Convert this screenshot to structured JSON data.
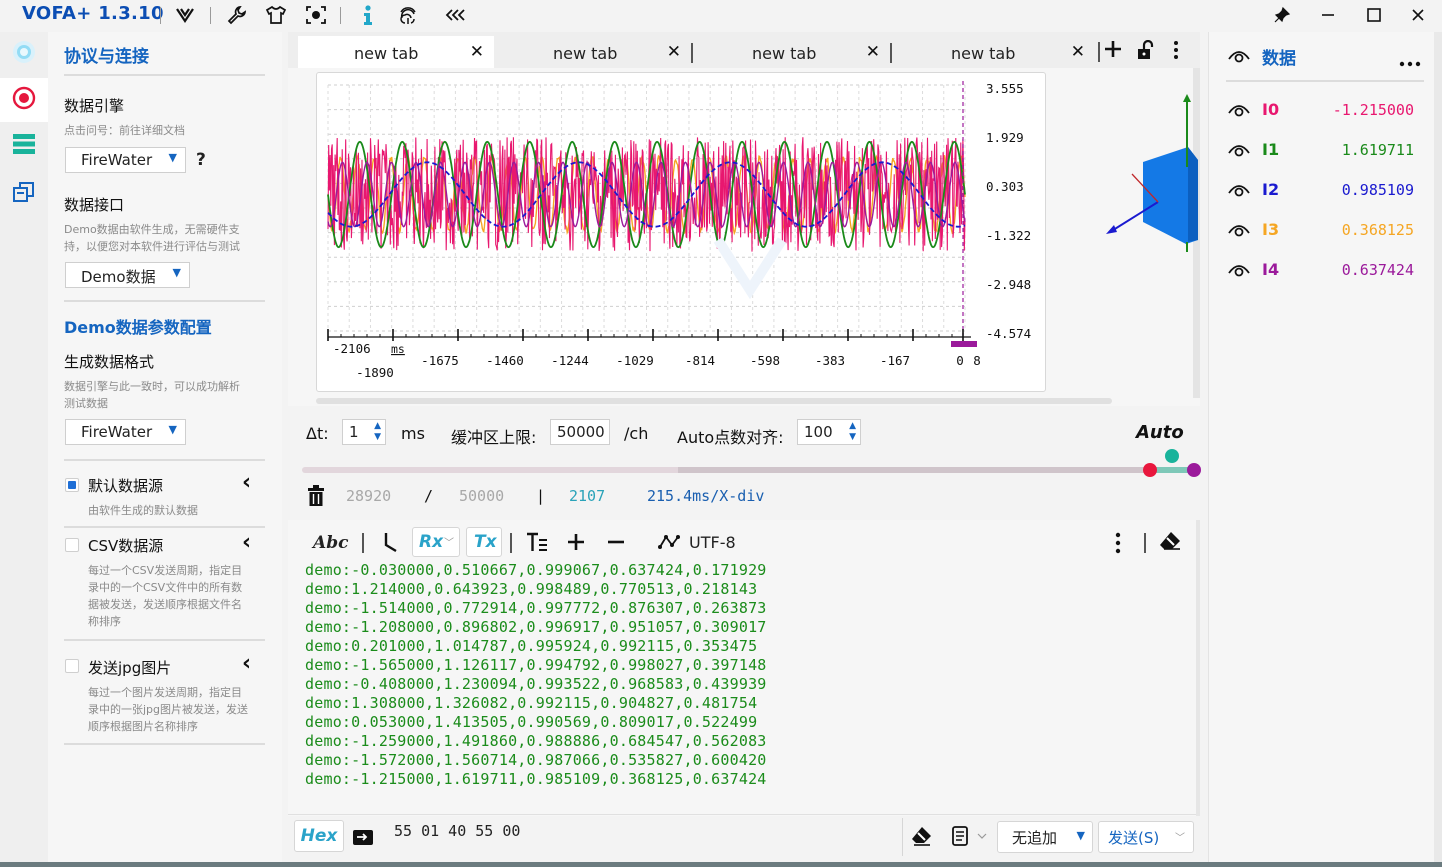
{
  "app": {
    "title": "VOFA+ 1.3.10"
  },
  "colors": {
    "accent": "#1565c0",
    "brand": "#0b4db3",
    "terminal_text": "#1b8c1b",
    "ch0": "#e8176f",
    "ch1": "#1a8a1a",
    "ch2": "#1a1acf",
    "ch3": "#f5a623",
    "ch4": "#9b1a9b"
  },
  "toolbar": {
    "icons": [
      "vofa-logo-icon",
      "wrench-icon",
      "shirt-icon",
      "camera-icon",
      "info-icon",
      "fingerprint-icon",
      "collapse-icon"
    ]
  },
  "left": {
    "section_title": "协议与连接",
    "engine_label": "数据引擎",
    "engine_hint": "点击问号：前往详细文档",
    "engine_value": "FireWater",
    "help": "?",
    "interface_label": "数据接口",
    "interface_hint_1": "Demo数据由软件生成，无需硬件支",
    "interface_hint_2": "持，以便您对本软件进行评估与测试",
    "interface_value": "Demo数据",
    "demo_section_title": "Demo数据参数配置",
    "format_label": "生成数据格式",
    "format_hint_1": "数据引擎与此一致时，可以成功解析",
    "format_hint_2": "测试数据",
    "format_value": "FireWater",
    "sources": [
      {
        "label": "默认数据源",
        "checked": true,
        "hint": [
          "由软件生成的默认数据"
        ]
      },
      {
        "label": "CSV数据源",
        "checked": false,
        "hint": [
          "每过一个CSV发送周期，指定目",
          "录中的一个CSV文件中的所有数",
          "据被发送，发送顺序根据文件名",
          "称排序"
        ]
      },
      {
        "label": "发送jpg图片",
        "checked": false,
        "hint": [
          "每过一个图片发送周期，指定目",
          "录中的一张jpg图片被发送，发送",
          "顺序根据图片名称排序"
        ]
      }
    ]
  },
  "tabs": [
    "new tab",
    "new tab",
    "new tab",
    "new tab"
  ],
  "chart_data": {
    "type": "line",
    "y_ticks": [
      "3.555",
      "1.929",
      "0.303",
      "-1.322",
      "-2.948",
      "-4.574"
    ],
    "ylim": [
      -4.574,
      3.555
    ],
    "x_ticks_top": [
      "-2106",
      "ms"
    ],
    "x_ticks": [
      "-1890",
      "-1675",
      "-1460",
      "-1244",
      "-1029",
      "-814",
      "-598",
      "-383",
      "-167",
      "0",
      "8"
    ],
    "xlabel": "ms",
    "series": [
      {
        "name": "I0",
        "color": "#e8176f"
      },
      {
        "name": "I1",
        "color": "#1a8a1a"
      },
      {
        "name": "I2",
        "color": "#1a1acf"
      },
      {
        "name": "I3",
        "color": "#f5a623"
      },
      {
        "name": "I4",
        "color": "#9b1a9b"
      }
    ]
  },
  "controls": {
    "dt_label": "Δt:",
    "dt_value": "1",
    "dt_unit": "ms",
    "buffer_label": "缓冲区上限:",
    "buffer_value": "50000",
    "buffer_unit": "/ch",
    "align_label": "Auto点数对齐:",
    "align_value": "100",
    "auto": "Auto",
    "count": "28920",
    "slash": "/",
    "limit": "50000",
    "bar": "|",
    "points": "2107",
    "xdiv": "215.4ms/X-div"
  },
  "terminal": {
    "abc": "Abc",
    "rx": "Rx",
    "tx": "Tx",
    "encoding": "UTF-8",
    "lines": [
      "demo:-0.030000,0.510667,0.999067,0.637424,0.171929",
      "demo:1.214000,0.643923,0.998489,0.770513,0.218143",
      "demo:-1.514000,0.772914,0.997772,0.876307,0.263873",
      "demo:-1.208000,0.896802,0.996917,0.951057,0.309017",
      "demo:0.201000,1.014787,0.995924,0.992115,0.353475",
      "demo:-1.565000,1.126117,0.994792,0.998027,0.397148",
      "demo:-0.408000,1.230094,0.993522,0.968583,0.439939",
      "demo:1.308000,1.326082,0.992115,0.904827,0.481754",
      "demo:0.053000,1.413505,0.990569,0.809017,0.522499",
      "demo:-1.259000,1.491860,0.988886,0.684547,0.562083",
      "demo:-1.572000,1.560714,0.987066,0.535827,0.600420",
      "demo:-1.215000,1.619711,0.985109,0.368125,0.637424"
    ]
  },
  "sendbar": {
    "hex": "Hex",
    "input_value": "55  01  40  55  00",
    "append": "无追加",
    "send": "发送(S)"
  },
  "right": {
    "title": "数据",
    "channels": [
      {
        "name": "I0",
        "value": "-1.215000",
        "color": "#e8176f"
      },
      {
        "name": "I1",
        "value": "1.619711",
        "color": "#1a8a1a"
      },
      {
        "name": "I2",
        "value": "0.985109",
        "color": "#1a1acf"
      },
      {
        "name": "I3",
        "value": "0.368125",
        "color": "#f5a623"
      },
      {
        "name": "I4",
        "value": "0.637424",
        "color": "#9b1a9b"
      }
    ]
  }
}
